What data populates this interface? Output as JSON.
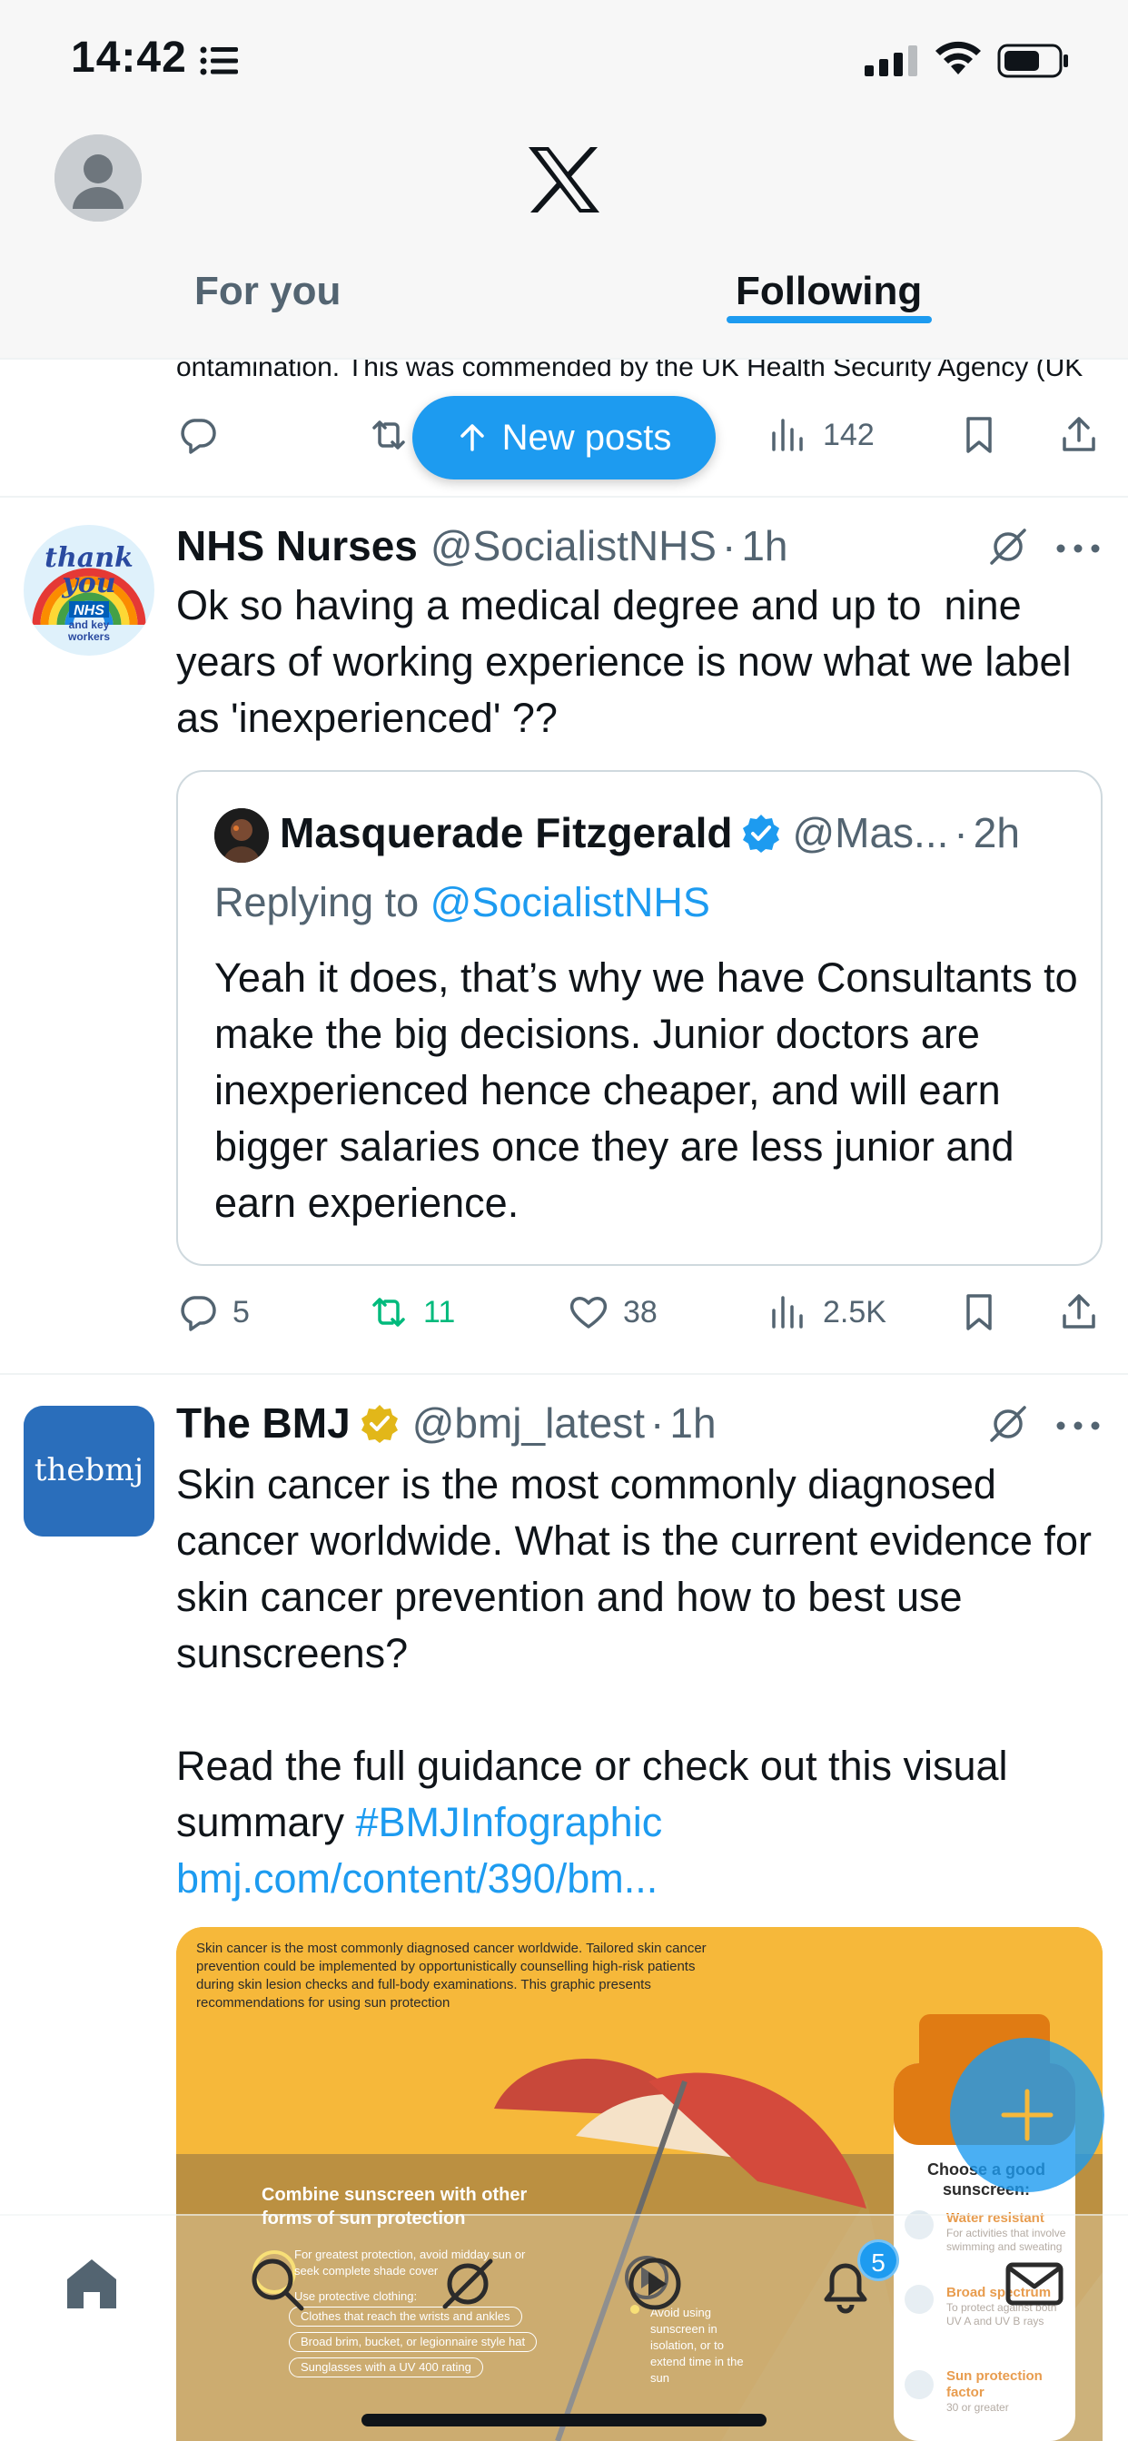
{
  "status_bar": {
    "time": "14:42"
  },
  "header": {
    "logo": "x-logo",
    "tabs": [
      {
        "label": "For you",
        "active": false
      },
      {
        "label": "Following",
        "active": true
      }
    ]
  },
  "previous_post": {
    "cut_text": "ontamination. This was commended by the UK Health Security Agency (UK",
    "views": "142"
  },
  "new_posts_label": "New posts",
  "posts": [
    {
      "name": "NHS Nurses",
      "handle": "@SocialistNHS",
      "age": "1h",
      "avatar_text": [
        "thank",
        "you",
        "NHS",
        "and key",
        "workers"
      ],
      "text": "Ok so having a medical degree and up to  nine years of working experience is now what we label as 'inexperienced' ??",
      "quote": {
        "name": "Masquerade Fitzgerald",
        "handle": "@Mas...",
        "age": "2h",
        "replying_prefix": "Replying to ",
        "replying_to": "@SocialistNHS",
        "text": "Yeah it does, that’s why we have Consultants to make the big decisions. Junior doctors are inexperienced hence cheaper, and will earn bigger salaries once they are less junior and earn experience."
      },
      "stats": {
        "replies": "5",
        "reposts": "11",
        "likes": "38",
        "views": "2.5K"
      }
    },
    {
      "name": "The BMJ",
      "handle": "@bmj_latest",
      "age": "1h",
      "avatar_text": "thebmj",
      "text": "Skin cancer is the most commonly diagnosed cancer worldwide. What is the current evidence for skin cancer prevention and how to best use sunscreens?",
      "text2": "Read the full guidance or check out this visual summary ",
      "hashtag": "#BMJInfographic",
      "link": "bmj.com/content/390/bm...",
      "media": {
        "caption": "Skin cancer is the most commonly diagnosed cancer worldwide. Tailored skin cancer prevention could be implemented by opportunistically counselling high-risk patients during skin lesion checks and full-body examinations. This graphic presents recommendations for using sun protection",
        "heading": "Combine sunscreen with other forms of sun protection",
        "sub": "For greatest protection, avoid midday sun or seek complete shade cover",
        "sub2": "Use protective clothing:",
        "pills": [
          "Clothes that reach the wrists and ankles",
          "Broad brim, bucket, or legionnaire style hat",
          "Sunglasses with a UV 400 rating"
        ],
        "note": "Avoid using sunscreen in isolation, or to extend time in the sun",
        "bottle_title": "Choose a good sunscreen:",
        "bottle_items": [
          {
            "title": "Water resistant",
            "desc": "For activities that involve swimming and sweating"
          },
          {
            "title": "Broad spectrum",
            "desc": "To protect against both UV A and UV B rays"
          },
          {
            "title": "Sun protection factor",
            "desc": "30 or greater"
          }
        ]
      }
    }
  ],
  "bottom_nav": {
    "items": [
      "home-icon",
      "search-icon",
      "grok-icon",
      "spaces-icon",
      "notifications-icon",
      "messages-icon"
    ],
    "notification_count": "5"
  },
  "colors": {
    "accent": "#1d9bf0",
    "repost_active": "#00ba7c",
    "secondary_text": "#536471",
    "verified_gold": "#e2b719"
  }
}
